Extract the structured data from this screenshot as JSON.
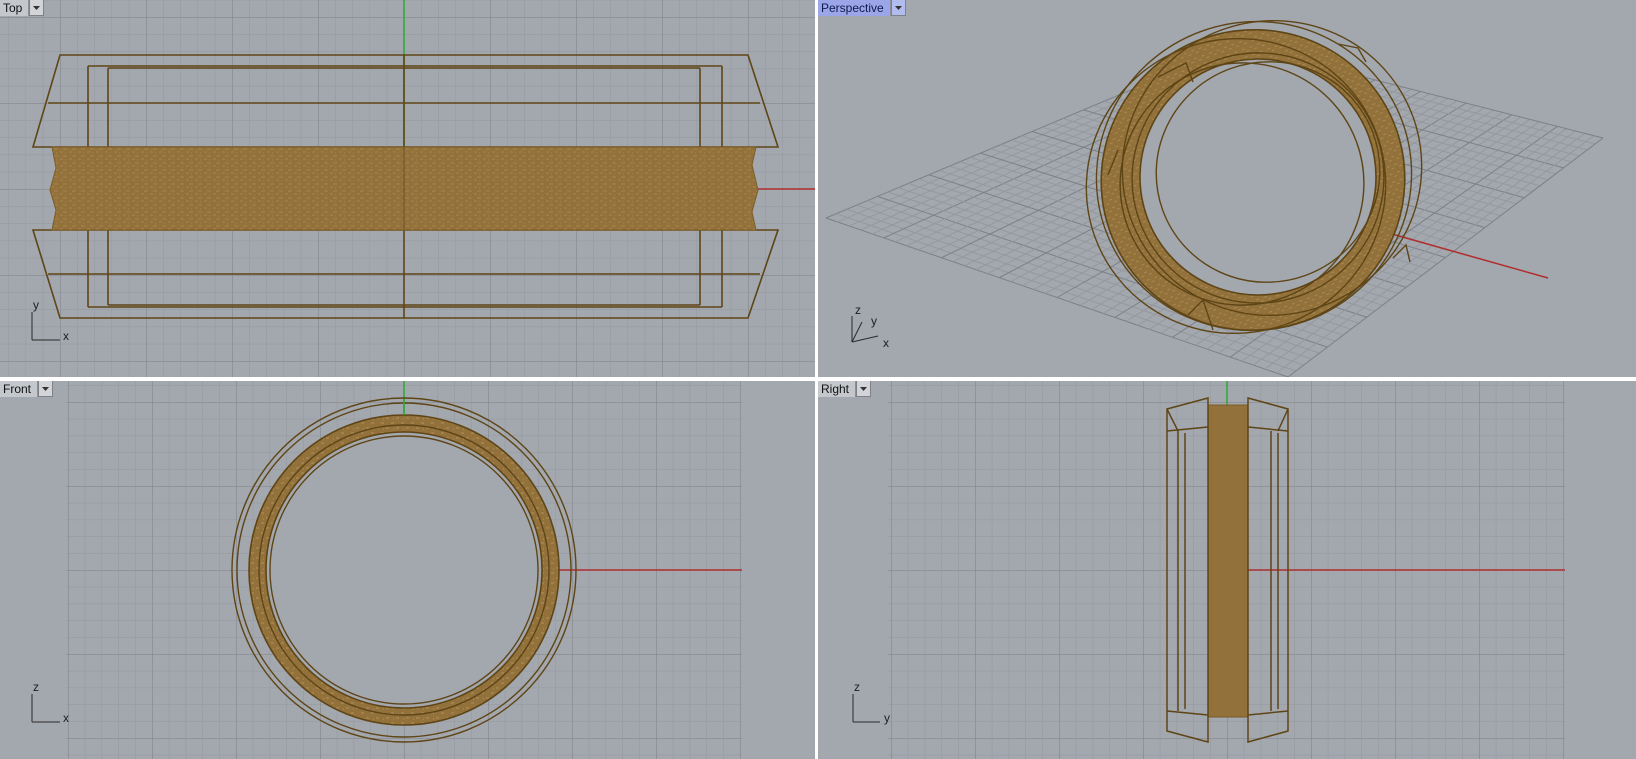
{
  "viewports": {
    "top": {
      "label": "Top",
      "axis_h": "x",
      "axis_v": "y"
    },
    "persp": {
      "label": "Perspective",
      "axis_a": "z",
      "axis_b": "y",
      "axis_c": "x"
    },
    "front": {
      "label": "Front",
      "axis_h": "x",
      "axis_v": "z"
    },
    "right": {
      "label": "Right",
      "axis_h": "y",
      "axis_v": "z"
    }
  },
  "active_viewport": "Perspective",
  "colors": {
    "background": "#a3a7ae",
    "grid_minor": "#94989f",
    "grid_major": "#7c8087",
    "x_axis": "#b02d2d",
    "y_axis": "#2ea836",
    "object_wire": "#5e4516",
    "object_fill": "#93713b",
    "active_tab": "#9aa6e8"
  },
  "icons": {
    "viewport_menu": "chevron-down-icon",
    "gizmo": "axis-gizmo-icon"
  }
}
